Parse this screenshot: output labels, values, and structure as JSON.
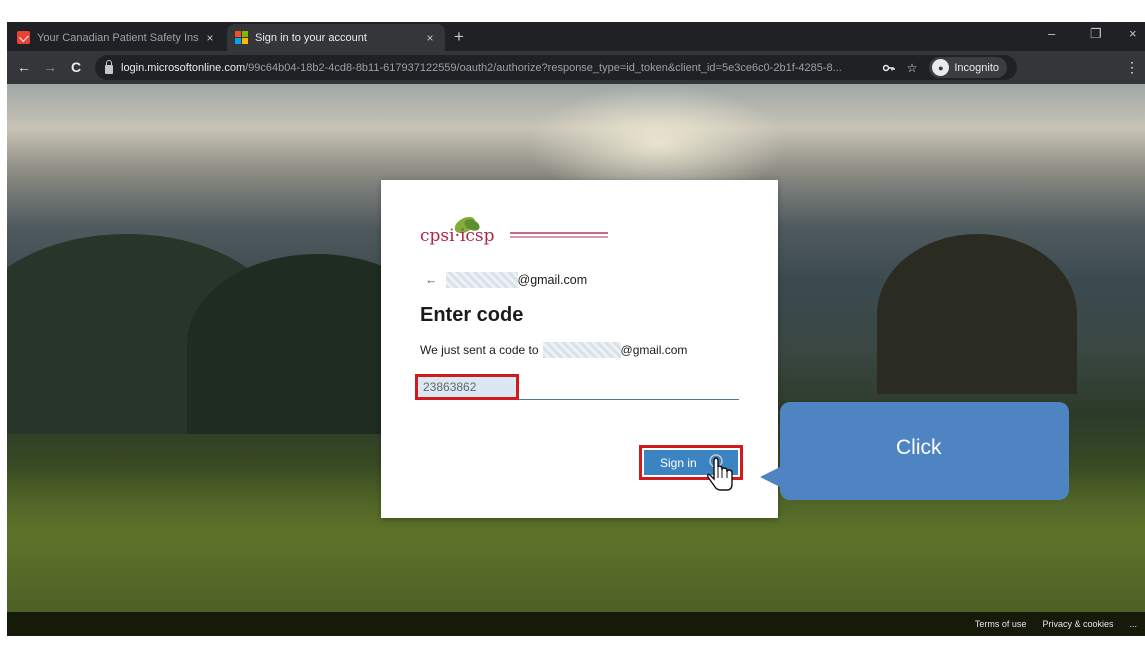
{
  "browser": {
    "tabs": [
      {
        "title": "Your Canadian Patient Safety Ins",
        "close": "×",
        "active": false
      },
      {
        "title": "Sign in to your account",
        "close": "×",
        "active": true
      }
    ],
    "new_tab": "+",
    "window_controls": {
      "minimize": "–",
      "restore": "❐",
      "close": "×"
    },
    "nav": {
      "back": "←",
      "forward": "→",
      "reload": "C"
    },
    "url_host": "login.microsoftonline.com",
    "url_path": "/99c64b04-18b2-4cd8-8b11-617937122559/oauth2/authorize?response_type=id_token&client_id=5e3ce6c0-2b1f-4285-8...",
    "omnibox_icons": [
      "key-icon",
      "star-icon"
    ],
    "incognito_label": "Incognito",
    "menu": "⋮"
  },
  "card": {
    "logo_text": "cpsi·icsp",
    "back_arrow": "←",
    "email_suffix": "@gmail.com",
    "title": "Enter code",
    "desc_prefix": "We just sent a code to",
    "desc_suffix": "@gmail.com",
    "code_value": "23863862",
    "signin_label": "Sign in"
  },
  "callout": {
    "label": "Click"
  },
  "footer": {
    "terms": "Terms of use",
    "privacy": "Privacy & cookies",
    "more": "..."
  },
  "colors": {
    "accent": "#3b83c1",
    "highlight": "#d01a1e",
    "callout": "#4e84c1",
    "brand": "#b0264a"
  }
}
